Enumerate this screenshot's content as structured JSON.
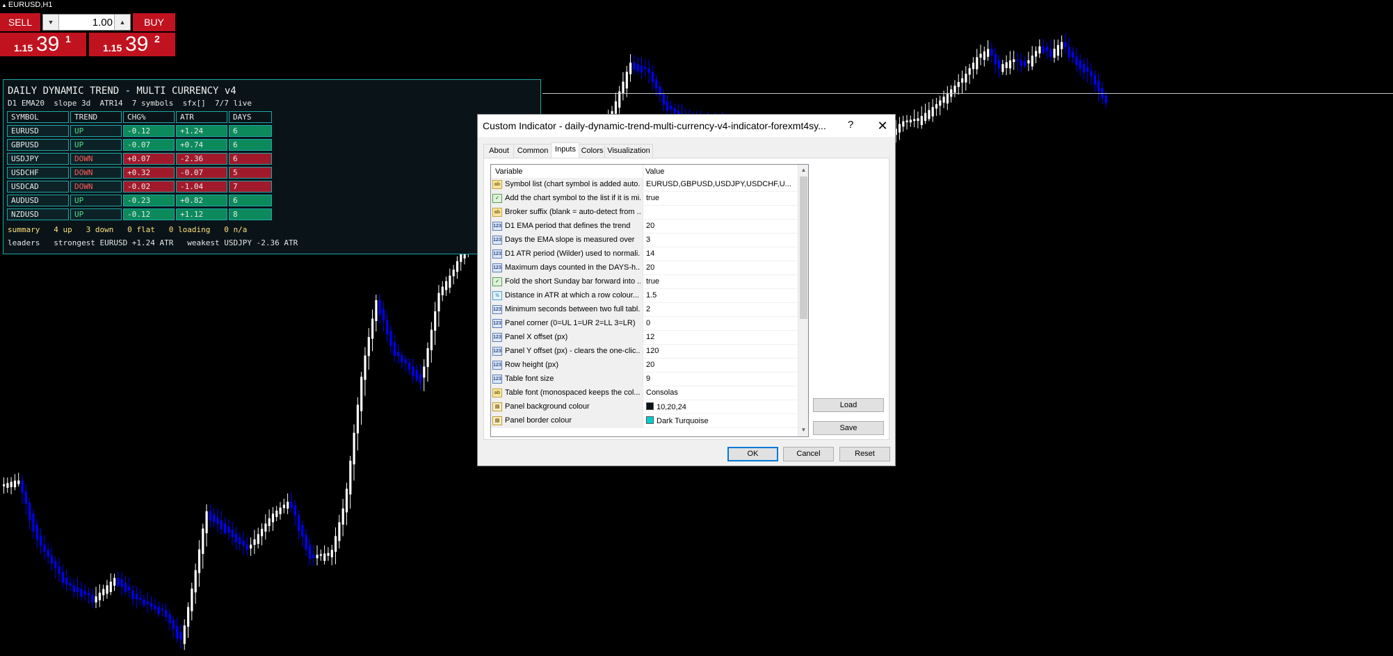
{
  "chart": {
    "title": "EURUSD,H1",
    "bull_color": "#ffffff",
    "bear_color": "#0000ff"
  },
  "one_click": {
    "sell_label": "SELL",
    "buy_label": "BUY",
    "lot_value": "1.00",
    "sell_price": {
      "small": "1.15",
      "big": "39",
      "sup": "1"
    },
    "buy_price": {
      "small": "1.15",
      "big": "39",
      "sup": "2"
    },
    "color": "#c1121f"
  },
  "panel": {
    "title": "DAILY DYNAMIC TREND - MULTI CURRENCY v4",
    "subtitle": "D1 EMA20  slope 3d  ATR14  7 symbols  sfx[]  7/7 live",
    "headers": [
      "SYMBOL",
      "TREND",
      "CHG%",
      "ATR",
      "DAYS"
    ],
    "rows": [
      {
        "symbol": "EURUSD",
        "trend": "UP",
        "chg": "-0.12",
        "atr": "+1.24",
        "days": "6"
      },
      {
        "symbol": "GBPUSD",
        "trend": "UP",
        "chg": "-0.07",
        "atr": "+0.74",
        "days": "6"
      },
      {
        "symbol": "USDJPY",
        "trend": "DOWN",
        "chg": "+0.07",
        "atr": "-2.36",
        "days": "6"
      },
      {
        "symbol": "USDCHF",
        "trend": "DOWN",
        "chg": "+0.32",
        "atr": "-0.07",
        "days": "5"
      },
      {
        "symbol": "USDCAD",
        "trend": "DOWN",
        "chg": "-0.02",
        "atr": "-1.04",
        "days": "7"
      },
      {
        "symbol": "AUDUSD",
        "trend": "UP",
        "chg": "-0.23",
        "atr": "+0.82",
        "days": "6"
      },
      {
        "symbol": "NZDUSD",
        "trend": "UP",
        "chg": "-0.12",
        "atr": "+1.12",
        "days": "8"
      }
    ],
    "summary": "summary   4 up   3 down   0 flat   0 loading   0 n/a",
    "leaders": "leaders   strongest EURUSD +1.24 ATR   weakest USDJPY -2.36 ATR",
    "colors": {
      "up_bg": "#0c8a5c",
      "down_bg": "#a11a2c",
      "border": "#1fa8a8",
      "bg": "#0a1418"
    }
  },
  "dialog": {
    "title": "Custom Indicator - daily-dynamic-trend-multi-currency-v4-indicator-forexmt4sy...",
    "help": "?",
    "close": "✕",
    "tabs": [
      "About",
      "Common",
      "Inputs",
      "Colors",
      "Visualization"
    ],
    "active_tab": "Inputs",
    "columns": [
      "Variable",
      "Value"
    ],
    "params": [
      {
        "icon": "ab",
        "variable": "Symbol list (chart symbol is added auto...",
        "value": "EURUSD,GBPUSD,USDJPY,USDCHF,U..."
      },
      {
        "icon": "bool",
        "variable": "Add the chart symbol to the list if it is mi...",
        "value": "true"
      },
      {
        "icon": "ab",
        "variable": "Broker suffix (blank = auto-detect from ...",
        "value": ""
      },
      {
        "icon": "123",
        "variable": "D1 EMA period that defines the trend",
        "value": "20"
      },
      {
        "icon": "123",
        "variable": "Days the EMA slope is measured over",
        "value": "3"
      },
      {
        "icon": "123",
        "variable": "D1 ATR period (Wilder) used to normali...",
        "value": "14"
      },
      {
        "icon": "123",
        "variable": "Maximum days counted in the DAYS-h...",
        "value": "20"
      },
      {
        "icon": "bool",
        "variable": "Fold the short Sunday bar forward into ...",
        "value": "true"
      },
      {
        "icon": "dbl",
        "variable": "Distance in ATR at which a row colour...",
        "value": "1.5"
      },
      {
        "icon": "123",
        "variable": "Minimum seconds between two full tabl...",
        "value": "2"
      },
      {
        "icon": "123",
        "variable": "Panel corner (0=UL 1=UR 2=LL 3=LR)",
        "value": "0"
      },
      {
        "icon": "123",
        "variable": "Panel X offset (px)",
        "value": "12"
      },
      {
        "icon": "123",
        "variable": "Panel Y offset (px) - clears the one-clic...",
        "value": "120"
      },
      {
        "icon": "123",
        "variable": "Row height (px)",
        "value": "20"
      },
      {
        "icon": "123",
        "variable": "Table font size",
        "value": "9"
      },
      {
        "icon": "ab",
        "variable": "Table font (monospaced keeps the col...",
        "value": "Consolas"
      },
      {
        "icon": "clr",
        "variable": "Panel background colour",
        "value": "10,20,24",
        "swatch": "#0a1418"
      },
      {
        "icon": "clr",
        "variable": "Panel border colour",
        "value": "Dark Turquoise",
        "swatch": "#00ced1"
      }
    ],
    "buttons": {
      "load": "Load",
      "save": "Save",
      "ok": "OK",
      "cancel": "Cancel",
      "reset": "Reset"
    }
  }
}
